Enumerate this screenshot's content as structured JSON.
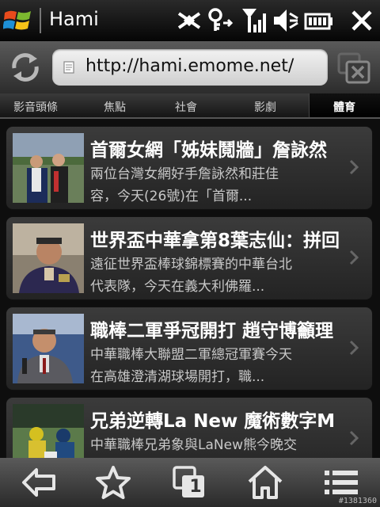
{
  "statusbar": {
    "app_title": "Hami",
    "icons": [
      "windows-logo",
      "bluetooth-icon",
      "sync-icon",
      "signal-icon",
      "volume-muted-icon",
      "battery-icon",
      "close-icon"
    ]
  },
  "browser": {
    "url": "http://hami.emome.net/",
    "icons": [
      "refresh-icon",
      "page-icon",
      "tabs-close-icon"
    ]
  },
  "categories": [
    {
      "label": "影音頭條",
      "active": false
    },
    {
      "label": "焦點",
      "active": false
    },
    {
      "label": "社會",
      "active": false
    },
    {
      "label": "影劇",
      "active": false
    },
    {
      "label": "體育",
      "active": true
    }
  ],
  "news": [
    {
      "title": "首爾女網「姊妹鬩牆」詹詠然",
      "desc1": "兩位台灣女網好手詹詠然和莊佳",
      "desc2": "容，今天(26號)在「首爾...",
      "thumb": "tennis-players-photo"
    },
    {
      "title": "世界盃中華拿第8葉志仙：拼回",
      "desc1": "遠征世界盃棒球錦標賽的中華台北",
      "desc2": "代表隊，今天在義大利佛羅...",
      "thumb": "coach-portrait-photo"
    },
    {
      "title": "職棒二軍爭冠開打 趙守博籲理",
      "desc1": "中華職棒大聯盟二軍總冠軍賽今天",
      "desc2": "在高雄澄清湖球場開打，職...",
      "thumb": "speaker-photo"
    },
    {
      "title": "兄弟逆轉La New 魔術數字M",
      "desc1": "中華職棒兄弟象與LaNew熊今晚交",
      "desc2": "",
      "thumb": "baseball-game-photo"
    }
  ],
  "toolbar": {
    "buttons": [
      "back-arrow-icon",
      "favorites-star-icon",
      "tabs-count-icon",
      "home-icon",
      "menu-icon"
    ],
    "tab_count": "1"
  },
  "watermark": "#1381360",
  "colors": {
    "background": "#1c1c1c",
    "item_bg": "#2e2e2e",
    "text_primary": "#ffffff",
    "text_secondary": "#c8c8c8",
    "url_field": "#e6e6e6"
  }
}
